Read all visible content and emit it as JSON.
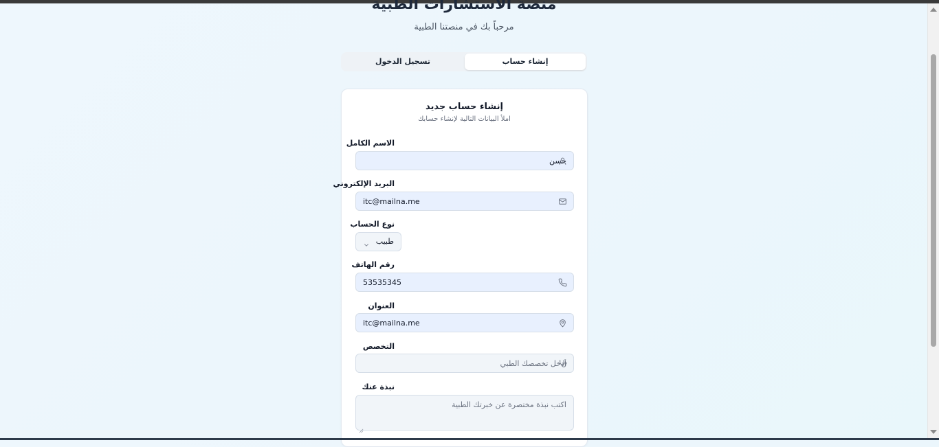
{
  "header": {
    "title": "منصة الاستشارات الطبية",
    "subtitle": "مرحباً بك في منصتنا الطبية"
  },
  "tabs": [
    {
      "label": "إنشاء حساب",
      "active": true
    },
    {
      "label": "تسجيل الدخول",
      "active": false
    }
  ],
  "form": {
    "title": "إنشاء حساب جديد",
    "description": "املأ البيانات التالية لإنشاء حسابك",
    "full_name": {
      "label": "الاسم الكامل",
      "value": "حسن",
      "icon": "user-icon"
    },
    "email": {
      "label": "البريد الإلكتروني",
      "value": "itc@mailna.me",
      "icon": "mail-icon"
    },
    "account_type": {
      "label": "نوع الحساب",
      "value": "طبيب",
      "icon": "chevron-down-icon"
    },
    "phone": {
      "label": "رقم الهاتف",
      "value": "53535345",
      "icon": "phone-icon"
    },
    "address": {
      "label": "العنوان",
      "value": "itc@mailna.me",
      "icon": "map-pin-icon"
    },
    "specialty": {
      "label": "التخصص",
      "placeholder": "أدخل تخصصك الطبي",
      "icon": "stethoscope-icon"
    },
    "bio": {
      "label": "نبذة عنك",
      "placeholder": "اكتب نبذة مختصرة عن خبرتك الطبية"
    }
  },
  "colors": {
    "background": "#ecf6fc",
    "field_filled": "#e8f0fe",
    "field_empty": "#f1f5f9",
    "text": "#111827"
  }
}
